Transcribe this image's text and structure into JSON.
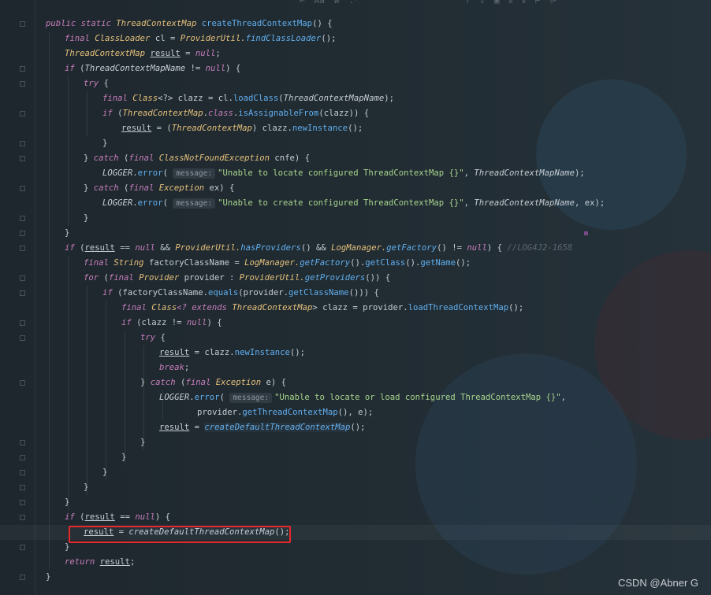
{
  "toolbar": {
    "left_labels": [
      "←",
      "Aa",
      "W",
      ".*"
    ],
    "right_labels": [
      "↑",
      "↓",
      "▣",
      "⫴",
      "⫴",
      "⊢",
      "⩥"
    ]
  },
  "code": {
    "lines": [
      [
        [
          "kw",
          "public static "
        ],
        [
          "cls",
          "ThreadContextMap "
        ],
        [
          "fn",
          "createThreadContextMap"
        ],
        [
          "p",
          "() {"
        ]
      ],
      [
        [
          "kw",
          "final "
        ],
        [
          "cls",
          "ClassLoader "
        ],
        [
          "p",
          "cl = "
        ],
        [
          "cls",
          "ProviderUtil."
        ],
        [
          "fn it",
          "findClassLoader"
        ],
        [
          "p",
          "();"
        ]
      ],
      [
        [
          "cls",
          "ThreadContextMap "
        ],
        [
          "p u",
          "result"
        ],
        [
          "p",
          " = "
        ],
        [
          "kw",
          "null"
        ],
        [
          "p",
          ";"
        ]
      ],
      [
        [
          "kw",
          "if "
        ],
        [
          "p",
          "("
        ],
        [
          "it",
          "ThreadContextMapName"
        ],
        [
          "p",
          " != "
        ],
        [
          "kw",
          "null"
        ],
        [
          "p",
          ") {"
        ]
      ],
      [
        [
          "kw",
          "try "
        ],
        [
          "p",
          "{"
        ]
      ],
      [
        [
          "kw",
          "final "
        ],
        [
          "cls",
          "Class"
        ],
        [
          "p",
          "<?> clazz = cl."
        ],
        [
          "fn",
          "loadClass"
        ],
        [
          "p",
          "("
        ],
        [
          "it",
          "ThreadContextMapName"
        ],
        [
          "p",
          ");"
        ]
      ],
      [
        [
          "kw",
          "if "
        ],
        [
          "p",
          "("
        ],
        [
          "cls",
          "ThreadContextMap"
        ],
        [
          "p",
          "."
        ],
        [
          "kw",
          "class"
        ],
        [
          "p",
          "."
        ],
        [
          "fn",
          "isAssignableFrom"
        ],
        [
          "p",
          "(clazz)) {"
        ]
      ],
      [
        [
          "p u",
          "result"
        ],
        [
          "p",
          " = ("
        ],
        [
          "cls",
          "ThreadContextMap"
        ],
        [
          "p",
          ") clazz."
        ],
        [
          "fn",
          "newInstance"
        ],
        [
          "p",
          "();"
        ]
      ],
      [
        [
          "p",
          "}"
        ]
      ],
      [
        [
          "p",
          "} "
        ],
        [
          "kw",
          "catch "
        ],
        [
          "p",
          "("
        ],
        [
          "kw",
          "final "
        ],
        [
          "cls",
          "ClassNotFoundException "
        ],
        [
          "p",
          "cnfe) {"
        ]
      ],
      [
        [
          "it",
          "LOGGER"
        ],
        [
          "p",
          "."
        ],
        [
          "fn",
          "error"
        ],
        [
          "p",
          "( "
        ],
        [
          "hint",
          "message:"
        ],
        [
          "str",
          "\"Unable to locate configured ThreadContextMap {}\""
        ],
        [
          "p",
          ", "
        ],
        [
          "it",
          "ThreadContextMapName"
        ],
        [
          "p",
          ");"
        ]
      ],
      [
        [
          "p",
          "} "
        ],
        [
          "kw",
          "catch "
        ],
        [
          "p",
          "("
        ],
        [
          "kw",
          "final "
        ],
        [
          "cls",
          "Exception "
        ],
        [
          "p",
          "ex) {"
        ]
      ],
      [
        [
          "it",
          "LOGGER"
        ],
        [
          "p",
          "."
        ],
        [
          "fn",
          "error"
        ],
        [
          "p",
          "( "
        ],
        [
          "hint",
          "message:"
        ],
        [
          "str",
          "\"Unable to create configured ThreadContextMap {}\""
        ],
        [
          "p",
          ", "
        ],
        [
          "it",
          "ThreadContextMapName"
        ],
        [
          "p",
          ", ex);"
        ]
      ],
      [
        [
          "p",
          "}"
        ]
      ],
      [
        [
          "p",
          "}"
        ]
      ],
      [
        [
          "kw",
          "if "
        ],
        [
          "p",
          "("
        ],
        [
          "p u",
          "result"
        ],
        [
          "p",
          " == "
        ],
        [
          "kw",
          "null "
        ],
        [
          "p",
          "&& "
        ],
        [
          "cls",
          "ProviderUtil."
        ],
        [
          "fn it",
          "hasProviders"
        ],
        [
          "p",
          "() && "
        ],
        [
          "cls",
          "LogManager."
        ],
        [
          "fn it",
          "getFactory"
        ],
        [
          "p",
          "() != "
        ],
        [
          "kw",
          "null"
        ],
        [
          "p",
          ") { "
        ],
        [
          "com",
          "//LOG4J2-1658"
        ]
      ],
      [
        [
          "kw",
          "final "
        ],
        [
          "cls",
          "String "
        ],
        [
          "p",
          "factoryClassName = "
        ],
        [
          "cls",
          "LogManager."
        ],
        [
          "fn it",
          "getFactory"
        ],
        [
          "p",
          "()."
        ],
        [
          "fn",
          "getClass"
        ],
        [
          "p",
          "()."
        ],
        [
          "fn",
          "getName"
        ],
        [
          "p",
          "();"
        ]
      ],
      [
        [
          "kw",
          "for "
        ],
        [
          "p",
          "("
        ],
        [
          "kw",
          "final "
        ],
        [
          "cls",
          "Provider "
        ],
        [
          "p",
          "provider : "
        ],
        [
          "cls",
          "ProviderUtil."
        ],
        [
          "fn it",
          "getProviders"
        ],
        [
          "p",
          "()) {"
        ]
      ],
      [
        [
          "kw",
          "if "
        ],
        [
          "p",
          "(factoryClassName."
        ],
        [
          "fn",
          "equals"
        ],
        [
          "p",
          "(provider."
        ],
        [
          "fn",
          "getClassName"
        ],
        [
          "p",
          "())) {"
        ]
      ],
      [
        [
          "kw",
          "final "
        ],
        [
          "cls",
          "Class"
        ],
        [
          "kw",
          "<? extends "
        ],
        [
          "cls",
          "ThreadContextMap"
        ],
        [
          "p",
          "> clazz = provider."
        ],
        [
          "fn",
          "loadThreadContextMap"
        ],
        [
          "p",
          "();"
        ]
      ],
      [
        [
          "kw",
          "if "
        ],
        [
          "p",
          "(clazz != "
        ],
        [
          "kw",
          "null"
        ],
        [
          "p",
          ") {"
        ]
      ],
      [
        [
          "kw",
          "try "
        ],
        [
          "p",
          "{"
        ]
      ],
      [
        [
          "p u",
          "result"
        ],
        [
          "p",
          " = clazz."
        ],
        [
          "fn",
          "newInstance"
        ],
        [
          "p",
          "();"
        ]
      ],
      [
        [
          "kw",
          "break"
        ],
        [
          "p",
          ";"
        ]
      ],
      [
        [
          "p",
          "} "
        ],
        [
          "kw",
          "catch "
        ],
        [
          "p",
          "("
        ],
        [
          "kw",
          "final "
        ],
        [
          "cls",
          "Exception "
        ],
        [
          "p",
          "e) {"
        ]
      ],
      [
        [
          "it",
          "LOGGER"
        ],
        [
          "p",
          "."
        ],
        [
          "fn",
          "error"
        ],
        [
          "p",
          "( "
        ],
        [
          "hint",
          "message:"
        ],
        [
          "str",
          "\"Unable to locate or load configured ThreadContextMap {}\""
        ],
        [
          "p",
          ","
        ]
      ],
      [
        [
          "p",
          "provider."
        ],
        [
          "fn",
          "getThreadContextMap"
        ],
        [
          "p",
          "(), e);"
        ]
      ],
      [
        [
          "p u",
          "result"
        ],
        [
          "p",
          " = "
        ],
        [
          "fn it hl",
          "createDefaultThreadContextMap"
        ],
        [
          "p",
          "();"
        ]
      ],
      [
        [
          "p",
          "}"
        ]
      ],
      [
        [
          "p",
          "}"
        ]
      ],
      [
        [
          "p",
          "}"
        ]
      ],
      [
        [
          "p",
          "}"
        ]
      ],
      [
        [
          "p",
          "}"
        ]
      ],
      [
        [
          "kw",
          "if "
        ],
        [
          "p",
          "("
        ],
        [
          "p u",
          "result"
        ],
        [
          "p",
          " == "
        ],
        [
          "kw",
          "null"
        ],
        [
          "p",
          ") {"
        ]
      ],
      [
        [
          "p u",
          "result"
        ],
        [
          "p",
          " = "
        ],
        [
          "it hl",
          "createDefaultThreadContextMap"
        ],
        [
          "p",
          "();"
        ]
      ],
      [
        [
          "p",
          "}"
        ]
      ],
      [
        [
          "kw",
          "return "
        ],
        [
          "p u",
          "result"
        ],
        [
          "p",
          ";"
        ]
      ],
      [
        [
          "p",
          "}"
        ]
      ]
    ]
  },
  "watermark": "CSDN @Abner G"
}
